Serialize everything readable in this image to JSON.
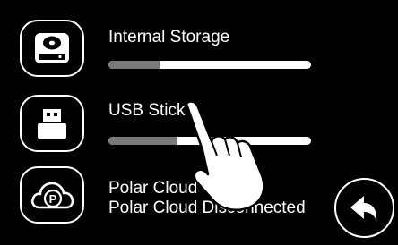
{
  "storage": {
    "internal": {
      "label": "Internal Storage",
      "usage_fraction": 0.25
    },
    "usb": {
      "label": "USB Stick",
      "usage_fraction": 0.34
    }
  },
  "cloud": {
    "title": "Polar Cloud",
    "status": "Polar Cloud Disconnected"
  },
  "icons": {
    "internal": "hard-drive-icon",
    "usb": "usb-stick-icon",
    "cloud": "polar-cloud-icon",
    "back": "back-arrow-icon",
    "pointer": "pointing-hand-icon"
  },
  "colors": {
    "background": "#000000",
    "foreground": "#ffffff",
    "bar_fill": "#7a7a7a",
    "bar_track": "#ffffff"
  }
}
